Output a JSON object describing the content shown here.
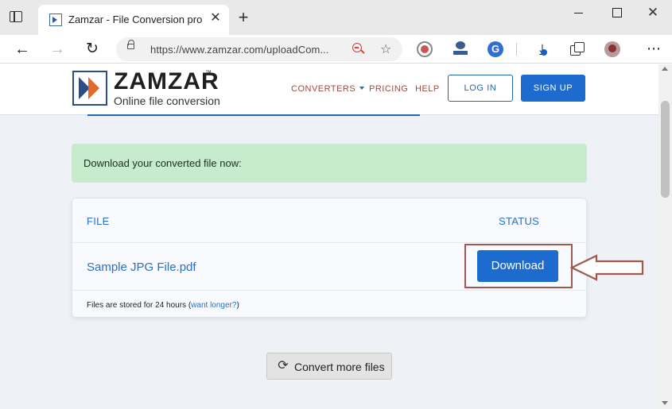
{
  "browser": {
    "tab_title": "Zamzar - File Conversion progress",
    "tab_close": "✕",
    "new_tab": "+",
    "url": "https://www.zamzar.com/uploadCom...",
    "window_controls": {
      "minimize": "",
      "maximize": "",
      "close": "✕"
    },
    "icons": {
      "back": "←",
      "forward": "→",
      "reload": "↻",
      "favorite": "☆",
      "extension_g": "G",
      "download": "⤓",
      "menu": "⋯"
    }
  },
  "site": {
    "logo_name": "ZAMZAR",
    "logo_tm": "™",
    "logo_tagline": "Online file conversion",
    "nav": {
      "converters": "CONVERTERS",
      "pricing": "PRICING",
      "help": "HELP",
      "login": "LOG IN",
      "signup": "SIGN UP"
    },
    "accent_color": "#1e6bd0",
    "link_color": "#a14a3c"
  },
  "main": {
    "alert_text": "Download your converted file now:",
    "table": {
      "col_file": "FILE",
      "col_status": "STATUS",
      "rows": [
        {
          "file_name": "Sample JPG File.pdf",
          "action": "Download"
        }
      ]
    },
    "footnote_prefix": "Files are stored for 24 hours (",
    "footnote_link": "want longer?",
    "footnote_suffix": ")",
    "convert_more": "Convert more files",
    "convert_icon": "⟳"
  },
  "annotation": {
    "highlight_color": "#a0584f"
  }
}
